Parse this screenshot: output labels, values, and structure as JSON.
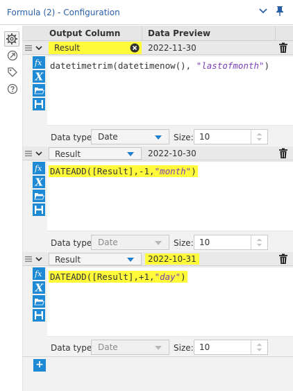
{
  "window": {
    "title": "Formula (2) - Configuration"
  },
  "header": {
    "output_column": "Output Column",
    "data_preview": "Data Preview"
  },
  "rows": [
    {
      "column": "Result",
      "preview": "2022-11-30",
      "expression_func": "datetimetrim(datetimenow(), ",
      "expression_str": "\"lastofmonth\"",
      "expression_end": ")",
      "data_type_label": "Data type:",
      "data_type": "Date",
      "size_label": "Size:",
      "size": "10"
    },
    {
      "column": "Result",
      "preview": "2022-10-30",
      "expression_func": "DATEADD([Result],-1,",
      "expression_str": "\"month\"",
      "expression_end": ")",
      "data_type_label": "Data type:",
      "data_type": "Date",
      "size_label": "Size:",
      "size": "10"
    },
    {
      "column": "Result",
      "preview": "2022-10-31",
      "expression_func": "DATEADD([Result],+1,",
      "expression_str": "\"day\"",
      "expression_end": ")",
      "data_type_label": "Data type:",
      "data_type": "Date",
      "size_label": "Size:",
      "size": "10"
    }
  ],
  "add_button": "+",
  "icons": {
    "title_chevron": "chevron-down-icon",
    "title_pin": "pin-icon",
    "rail": [
      "gear-icon",
      "connection-icon",
      "tag-icon",
      "help-icon"
    ],
    "row_tools": [
      "fx-icon",
      "variable-x-icon",
      "open-folder-icon",
      "save-icon"
    ],
    "clear": "clear-circle-icon",
    "trash": "trash-icon"
  },
  "colors": {
    "accent": "#1e8ad6",
    "highlight": "#fffb3a",
    "title_text": "#2a5fa8",
    "string_literal": "#7a3fb8"
  }
}
